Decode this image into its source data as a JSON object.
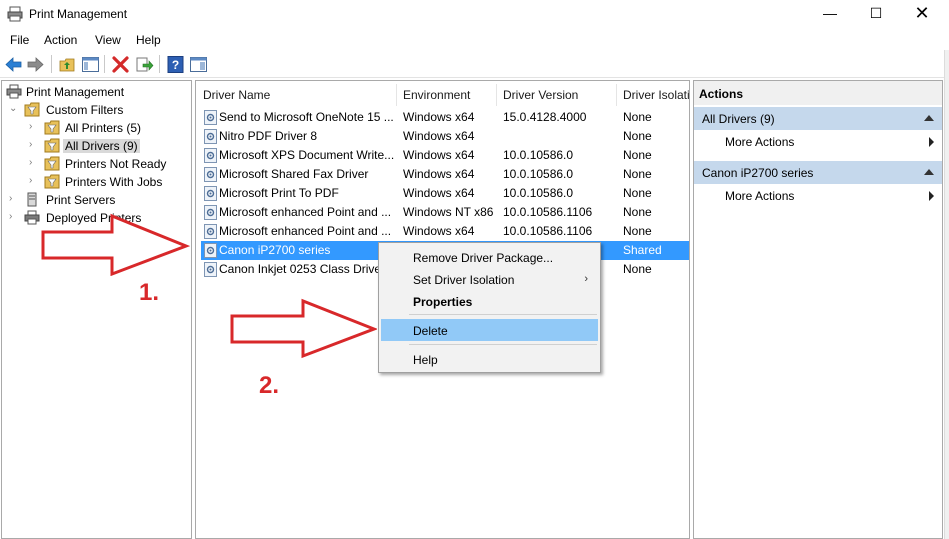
{
  "window": {
    "title": "Print Management",
    "minimize_glyph": "—",
    "maximize_glyph": "☐",
    "close_glyph": "✕"
  },
  "menu": [
    "File",
    "Action",
    "View",
    "Help"
  ],
  "toolbar": {
    "icons": [
      "back-icon",
      "forward-icon",
      "up-folder-icon",
      "show-hide-console-tree-icon",
      "delete-icon",
      "export-list-icon",
      "help-icon",
      "show-hide-action-pane-icon"
    ]
  },
  "tree": {
    "root": "Print Management",
    "custom_filters": "Custom Filters",
    "all_printers": "All Printers (5)",
    "all_drivers": "All Drivers (9)",
    "printers_not_ready": "Printers Not Ready",
    "printers_with_jobs": "Printers With Jobs",
    "print_servers": "Print Servers",
    "deployed_printers": "Deployed Printers"
  },
  "list": {
    "columns": [
      "Driver Name",
      "Environment",
      "Driver Version",
      "Driver Isolati"
    ],
    "rows": [
      {
        "name": "Send to Microsoft OneNote 15 ...",
        "env": "Windows x64",
        "version": "15.0.4128.4000",
        "isolation": "None"
      },
      {
        "name": "Nitro PDF Driver 8",
        "env": "Windows x64",
        "version": "",
        "isolation": "None"
      },
      {
        "name": "Microsoft XPS Document Write...",
        "env": "Windows x64",
        "version": "10.0.10586.0",
        "isolation": "None"
      },
      {
        "name": "Microsoft Shared Fax Driver",
        "env": "Windows x64",
        "version": "10.0.10586.0",
        "isolation": "None"
      },
      {
        "name": "Microsoft Print To PDF",
        "env": "Windows x64",
        "version": "10.0.10586.0",
        "isolation": "None"
      },
      {
        "name": "Microsoft enhanced Point and ...",
        "env": "Windows NT x86",
        "version": "10.0.10586.1106",
        "isolation": "None"
      },
      {
        "name": "Microsoft enhanced Point and ...",
        "env": "Windows x64",
        "version": "10.0.10586.1106",
        "isolation": "None"
      },
      {
        "name": "Canon iP2700 series",
        "env": "",
        "version": "",
        "isolation": "Shared"
      },
      {
        "name": "Canon Inkjet 0253 Class Driver",
        "env": "",
        "version": "",
        "isolation": "None"
      }
    ],
    "selected_index": 7
  },
  "actions": {
    "title": "Actions",
    "group1": "All Drivers (9)",
    "group1_more": "More Actions",
    "group2": "Canon iP2700 series",
    "group2_more": "More Actions"
  },
  "context_menu": {
    "remove": "Remove Driver Package...",
    "isolation": "Set Driver Isolation",
    "isolation_sub": "›",
    "properties": "Properties",
    "delete": "Delete",
    "help": "Help"
  },
  "annotations": {
    "step1": "1.",
    "step2": "2.",
    "color": "#d8282a"
  },
  "colors": {
    "selection": "#3399ff",
    "context_highlight": "#91c9f7",
    "actions_group": "#c5d8ec"
  }
}
